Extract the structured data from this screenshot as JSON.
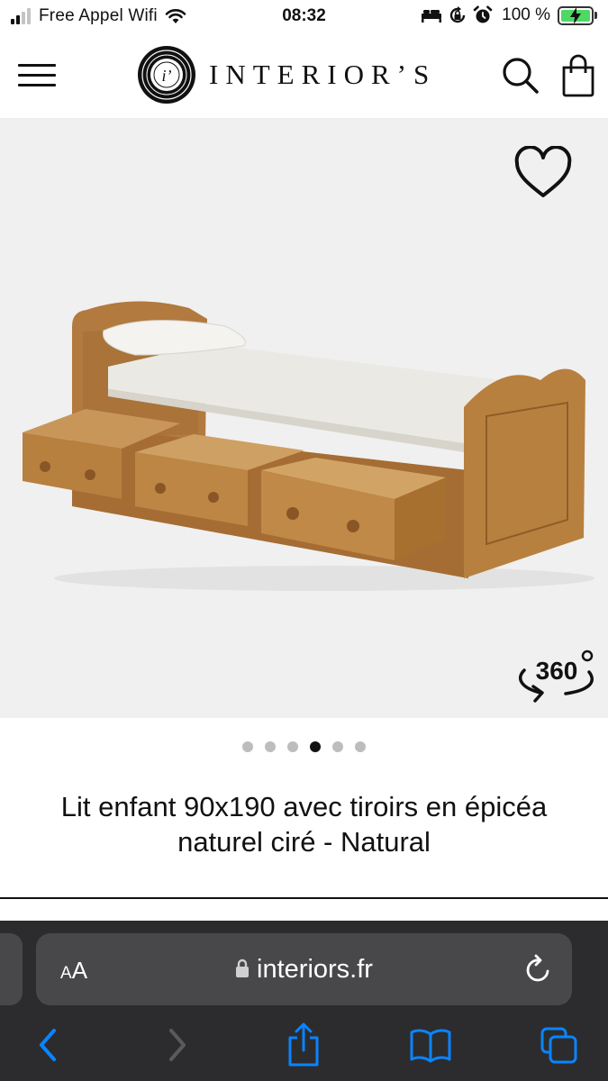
{
  "status_bar": {
    "carrier": "Free Appel Wifi",
    "time": "08:32",
    "battery_percent": "100 %",
    "icons": [
      "signal-icon",
      "wifi-icon",
      "bed-icon",
      "orientation-lock-icon",
      "alarm-icon",
      "battery-charging-icon"
    ]
  },
  "header": {
    "brand": "INTERIOR’S",
    "logo_mark_text": "i’",
    "icons": [
      "menu-icon",
      "search-icon",
      "shopping-bag-icon"
    ]
  },
  "gallery": {
    "view_360_label": "360",
    "slide_count": 6,
    "active_slide": 4,
    "background_color": "#f0f0f0"
  },
  "product": {
    "title": "Lit enfant 90x190 avec tiroirs en épicéa naturel ciré - Natural"
  },
  "browser": {
    "text_size_label_small": "A",
    "text_size_label_large": "A",
    "url": "interiors.fr",
    "icons": [
      "lock-icon",
      "reload-icon",
      "back-icon",
      "forward-icon",
      "share-icon",
      "bookmarks-icon",
      "tabs-icon"
    ],
    "accent_color": "#0a84ff"
  }
}
